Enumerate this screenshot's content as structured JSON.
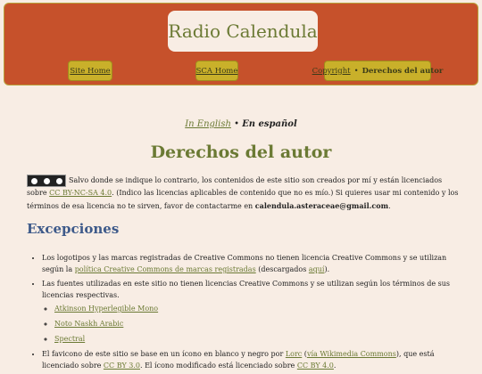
{
  "site": {
    "title": "Radio Calendula"
  },
  "nav": {
    "home": "Site Home",
    "sca": "SCA Home",
    "copyright": "Copyright",
    "separator": "•",
    "derechos": "Derechos del autor"
  },
  "lang": {
    "english": "In English",
    "separator": "•",
    "spanish": "En español"
  },
  "page": {
    "heading": "Derechos del autor",
    "intro_1": "Salvo donde se indique lo contrario, los contenidos de este sitio son creados por mí y están licenciados sobre ",
    "intro_link": "CC BY-NC-SA 4.0",
    "intro_2": ". (Indico las licencias aplicables de contenido que no es mío.) Si quieres usar mi contenido y los términos de esa licencia no te sirven, favor de contactarme en ",
    "email": "calendula.asteraceae@gmail.com",
    "intro_3": "."
  },
  "exceptions": {
    "heading": "Excepciones",
    "item1_a": "Los logotipos y las marcas registradas de Creative Commons no tienen licencia Creative Commons y se utilizan según la ",
    "item1_link": "política Creative Commons de marcas registradas",
    "item1_b": " (descargados ",
    "item1_link2": "aquí",
    "item1_c": ").",
    "item2": "Las fuentes utilizadas en este sitio no tienen licencias Creative Commons y se utilizan según los términos de sus licencias respectivas.",
    "fonts": [
      "Atkinson Hyperlegible Mono",
      "Noto Naskh Arabic",
      "Spectral"
    ],
    "item3_a": "El favicono de este sitio se base en un ícono en blanco y negro por ",
    "item3_link1": "Lorc",
    "item3_b": " (",
    "item3_link2": "vía Wikimedia Commons",
    "item3_c": "), que está licenciado sobre ",
    "item3_link3": "CC BY 3.0",
    "item3_d": ". El ícono modificado está licenciado sobre ",
    "item3_link4": "CC BY 4.0",
    "item3_e": "."
  }
}
